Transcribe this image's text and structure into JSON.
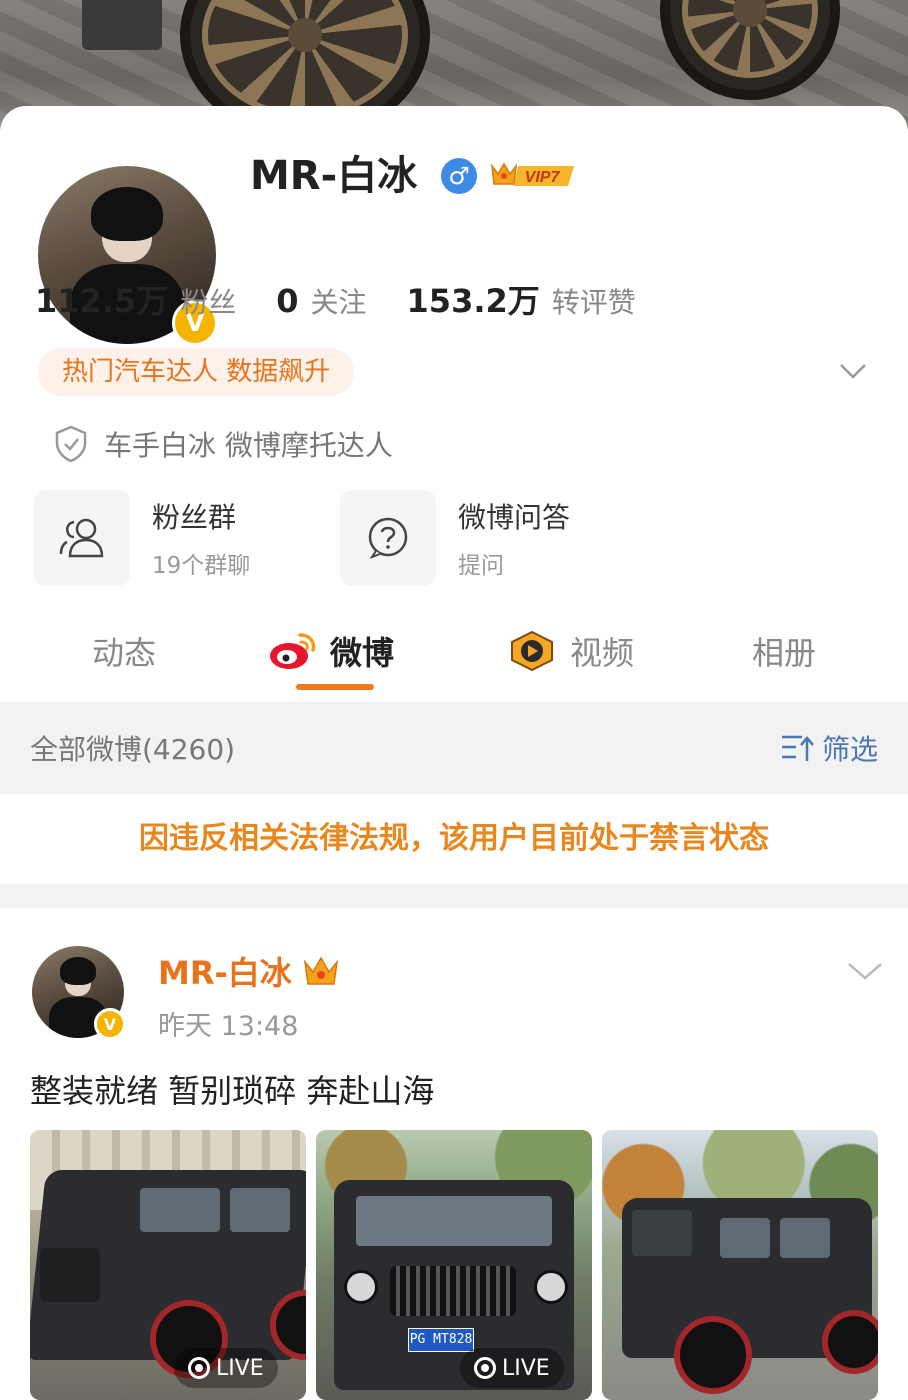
{
  "profile": {
    "name": "MR-白冰",
    "gender_symbol": "♂",
    "vip_label": "VIP7",
    "verified_symbol": "V"
  },
  "stats": [
    {
      "value": "112.5万",
      "label": "粉丝"
    },
    {
      "value": "0",
      "label": "关注"
    },
    {
      "value": "153.2万",
      "label": "转评赞"
    }
  ],
  "hot_tag": "热门汽车达人 数据飙升",
  "certification": "车手白冰 微博摩托达人",
  "tiles": [
    {
      "title": "粉丝群",
      "subtitle": "19个群聊",
      "icon": "people-icon"
    },
    {
      "title": "微博问答",
      "subtitle": "提问",
      "icon": "question-icon"
    }
  ],
  "tabs": [
    {
      "label": "动态",
      "active": false
    },
    {
      "label": "微博",
      "active": true,
      "icon": "weibo-logo-icon"
    },
    {
      "label": "视频",
      "active": false,
      "icon": "video-play-icon"
    },
    {
      "label": "相册",
      "active": false
    }
  ],
  "filter_bar": {
    "all_label": "全部微博(4260)",
    "filter_label": "筛选"
  },
  "notice": "因违反相关法律法规，该用户目前处于禁言状态",
  "post": {
    "author": "MR-白冰",
    "time": "昨天 13:48",
    "text": "整装就绪 暂别琐碎 奔赴山海",
    "images": [
      {
        "live_label": "LIVE"
      },
      {
        "live_label": "LIVE",
        "plate": "PG MT828"
      },
      {
        "live_label": ""
      }
    ]
  },
  "colors": {
    "accent": "#e8731a",
    "tab_underline": "#f07b1e",
    "link_blue": "#4a78b5",
    "notice": "#e8871e",
    "vip_gold": "#f4b400"
  }
}
